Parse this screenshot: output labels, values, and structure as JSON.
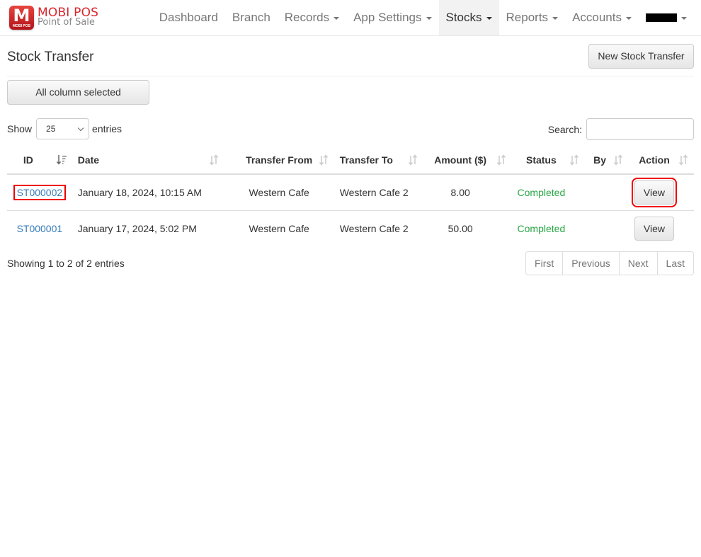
{
  "brand": {
    "logo_letter": "M",
    "logo_subtext": "MOBI POS",
    "title": "MOBI POS",
    "subtitle": "Point of Sale",
    "color": "#d9262c"
  },
  "nav": {
    "items": [
      {
        "label": "Dashboard",
        "dropdown": false,
        "active": false
      },
      {
        "label": "Branch",
        "dropdown": false,
        "active": false
      },
      {
        "label": "Records",
        "dropdown": true,
        "active": false
      },
      {
        "label": "App Settings",
        "dropdown": true,
        "active": false
      },
      {
        "label": "Stocks",
        "dropdown": true,
        "active": true
      },
      {
        "label": "Reports",
        "dropdown": true,
        "active": false
      },
      {
        "label": "Accounts",
        "dropdown": true,
        "active": false
      }
    ],
    "user_menu": "redacted-user"
  },
  "page": {
    "title": "Stock Transfer",
    "new_button": "New Stock Transfer",
    "columns_button": "All column selected"
  },
  "length_menu": {
    "show_label": "Show",
    "value": "25",
    "entries_label": "entries"
  },
  "search": {
    "label": "Search:",
    "value": "",
    "placeholder": ""
  },
  "table": {
    "columns": [
      "ID",
      "Date",
      "Transfer From",
      "Transfer To",
      "Amount ($)",
      "Status",
      "By",
      "Action"
    ],
    "rows": [
      {
        "id": "ST000002",
        "date": "January 18, 2024, 10:15 AM",
        "from": "Western Cafe",
        "to": "Western Cafe 2",
        "amount": "8.00",
        "status": "Completed",
        "by": "",
        "action": "View"
      },
      {
        "id": "ST000001",
        "date": "January 17, 2024, 5:02 PM",
        "from": "Western Cafe",
        "to": "Western Cafe 2",
        "amount": "50.00",
        "status": "Completed",
        "by": "",
        "action": "View"
      }
    ],
    "status_color": "#28a745",
    "link_color": "#337ab7"
  },
  "footer": {
    "info": "Showing 1 to 2 of 2 entries",
    "pagination": [
      "First",
      "Previous",
      "Next",
      "Last"
    ]
  }
}
